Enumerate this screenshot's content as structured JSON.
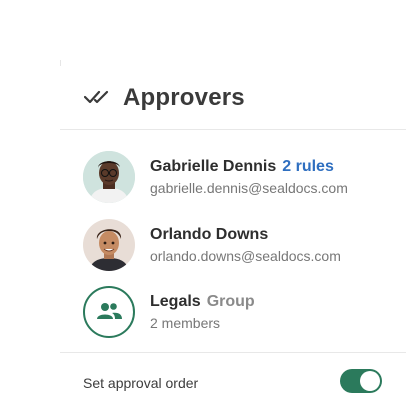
{
  "header": {
    "title": "Approvers",
    "icon": "double-check-icon"
  },
  "approvers": [
    {
      "name": "Gabrielle Dennis",
      "extra": "2 rules",
      "sub": "gabrielle.dennis@sealdocs.com",
      "avatar": "avatar-photo"
    },
    {
      "name": "Orlando Downs",
      "extra": "",
      "sub": "orlando.downs@sealdocs.com",
      "avatar": "avatar-photo"
    },
    {
      "name": "Legals",
      "extra": "Group",
      "sub": "2 members",
      "avatar": "group-icon"
    }
  ],
  "footer": {
    "label": "Set approval order",
    "toggle_on": true
  },
  "colors": {
    "accent": "#2b7a5c",
    "link": "#2f6fc0",
    "muted": "#777777"
  }
}
